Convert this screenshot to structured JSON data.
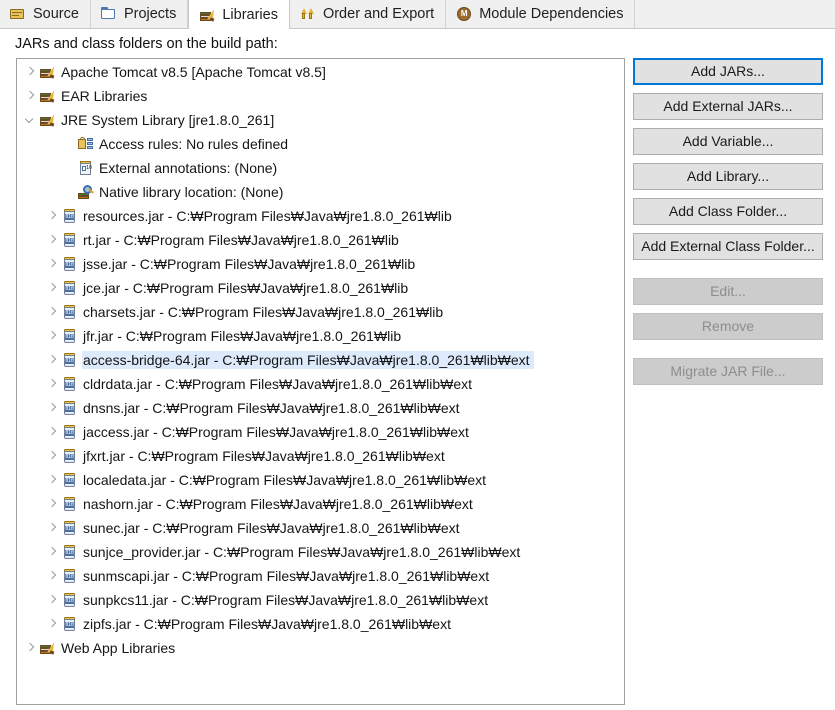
{
  "tabs": [
    {
      "label": "Source",
      "icon": "source-folder-icon",
      "active": false
    },
    {
      "label": "Projects",
      "icon": "projects-folder-icon",
      "active": false
    },
    {
      "label": "Libraries",
      "icon": "libraries-books-icon",
      "active": true
    },
    {
      "label": "Order and Export",
      "icon": "order-export-arrows-icon",
      "active": false
    },
    {
      "label": "Module Dependencies",
      "icon": "module-circle-icon",
      "active": false
    }
  ],
  "caption": "JARs and class folders on the build path:",
  "tree": [
    {
      "label": "Apache Tomcat v8.5 [Apache Tomcat v8.5]",
      "icon": "library-icon",
      "level": 1,
      "twisty": "closed",
      "selected": false
    },
    {
      "label": "EAR Libraries",
      "icon": "library-icon",
      "level": 1,
      "twisty": "closed",
      "selected": false
    },
    {
      "label": "JRE System Library [jre1.8.0_261]",
      "icon": "library-icon",
      "level": 1,
      "twisty": "open",
      "selected": false
    },
    {
      "label": "Access rules: No rules defined",
      "icon": "access-rules-lock-icon",
      "level": 3,
      "twisty": "none",
      "selected": false
    },
    {
      "label": "External annotations: (None)",
      "icon": "external-annotations-icon",
      "level": 3,
      "twisty": "none",
      "selected": false
    },
    {
      "label": "Native library location: (None)",
      "icon": "native-library-icon",
      "level": 3,
      "twisty": "none",
      "selected": false
    },
    {
      "label": "resources.jar - C:₩Program Files₩Java₩jre1.8.0_261₩lib",
      "icon": "jar-icon",
      "level": 2,
      "twisty": "closed",
      "selected": false
    },
    {
      "label": "rt.jar - C:₩Program Files₩Java₩jre1.8.0_261₩lib",
      "icon": "jar-icon",
      "level": 2,
      "twisty": "closed",
      "selected": false
    },
    {
      "label": "jsse.jar - C:₩Program Files₩Java₩jre1.8.0_261₩lib",
      "icon": "jar-icon",
      "level": 2,
      "twisty": "closed",
      "selected": false
    },
    {
      "label": "jce.jar - C:₩Program Files₩Java₩jre1.8.0_261₩lib",
      "icon": "jar-icon",
      "level": 2,
      "twisty": "closed",
      "selected": false
    },
    {
      "label": "charsets.jar - C:₩Program Files₩Java₩jre1.8.0_261₩lib",
      "icon": "jar-icon",
      "level": 2,
      "twisty": "closed",
      "selected": false
    },
    {
      "label": "jfr.jar - C:₩Program Files₩Java₩jre1.8.0_261₩lib",
      "icon": "jar-icon",
      "level": 2,
      "twisty": "closed",
      "selected": false
    },
    {
      "label": "access-bridge-64.jar - C:₩Program Files₩Java₩jre1.8.0_261₩lib₩ext",
      "icon": "jar-icon",
      "level": 2,
      "twisty": "closed",
      "selected": true
    },
    {
      "label": "cldrdata.jar - C:₩Program Files₩Java₩jre1.8.0_261₩lib₩ext",
      "icon": "jar-icon",
      "level": 2,
      "twisty": "closed",
      "selected": false
    },
    {
      "label": "dnsns.jar - C:₩Program Files₩Java₩jre1.8.0_261₩lib₩ext",
      "icon": "jar-icon",
      "level": 2,
      "twisty": "closed",
      "selected": false
    },
    {
      "label": "jaccess.jar - C:₩Program Files₩Java₩jre1.8.0_261₩lib₩ext",
      "icon": "jar-icon",
      "level": 2,
      "twisty": "closed",
      "selected": false
    },
    {
      "label": "jfxrt.jar - C:₩Program Files₩Java₩jre1.8.0_261₩lib₩ext",
      "icon": "jar-icon",
      "level": 2,
      "twisty": "closed",
      "selected": false
    },
    {
      "label": "localedata.jar - C:₩Program Files₩Java₩jre1.8.0_261₩lib₩ext",
      "icon": "jar-icon",
      "level": 2,
      "twisty": "closed",
      "selected": false
    },
    {
      "label": "nashorn.jar - C:₩Program Files₩Java₩jre1.8.0_261₩lib₩ext",
      "icon": "jar-icon",
      "level": 2,
      "twisty": "closed",
      "selected": false
    },
    {
      "label": "sunec.jar - C:₩Program Files₩Java₩jre1.8.0_261₩lib₩ext",
      "icon": "jar-icon",
      "level": 2,
      "twisty": "closed",
      "selected": false
    },
    {
      "label": "sunjce_provider.jar - C:₩Program Files₩Java₩jre1.8.0_261₩lib₩ext",
      "icon": "jar-icon",
      "level": 2,
      "twisty": "closed",
      "selected": false
    },
    {
      "label": "sunmscapi.jar - C:₩Program Files₩Java₩jre1.8.0_261₩lib₩ext",
      "icon": "jar-icon",
      "level": 2,
      "twisty": "closed",
      "selected": false
    },
    {
      "label": "sunpkcs11.jar - C:₩Program Files₩Java₩jre1.8.0_261₩lib₩ext",
      "icon": "jar-icon",
      "level": 2,
      "twisty": "closed",
      "selected": false
    },
    {
      "label": "zipfs.jar - C:₩Program Files₩Java₩jre1.8.0_261₩lib₩ext",
      "icon": "jar-icon",
      "level": 2,
      "twisty": "closed",
      "selected": false
    },
    {
      "label": "Web App Libraries",
      "icon": "library-icon",
      "level": 1,
      "twisty": "closed",
      "selected": false
    }
  ],
  "buttons": [
    {
      "label": "Add JARs...",
      "state": "focused"
    },
    {
      "label": "Add External JARs...",
      "state": "normal"
    },
    {
      "label": "Add Variable...",
      "state": "normal"
    },
    {
      "label": "Add Library...",
      "state": "normal"
    },
    {
      "label": "Add Class Folder...",
      "state": "normal"
    },
    {
      "label": "Add External Class Folder...",
      "state": "normal"
    },
    {
      "label": "Edit...",
      "state": "disabled",
      "spacer": "large"
    },
    {
      "label": "Remove",
      "state": "disabled"
    },
    {
      "label": "Migrate JAR File...",
      "state": "disabled",
      "spacer": "large"
    }
  ],
  "colors": {
    "focus_border": "#0078d7",
    "selection_bg": "#dceafb",
    "panel_border": "#a0a0a0",
    "tabbar_bg": "#f0f0f0",
    "button_bg": "#e1e1e1",
    "button_disabled_bg": "#cccccc"
  },
  "module_icon_glyph": "M"
}
